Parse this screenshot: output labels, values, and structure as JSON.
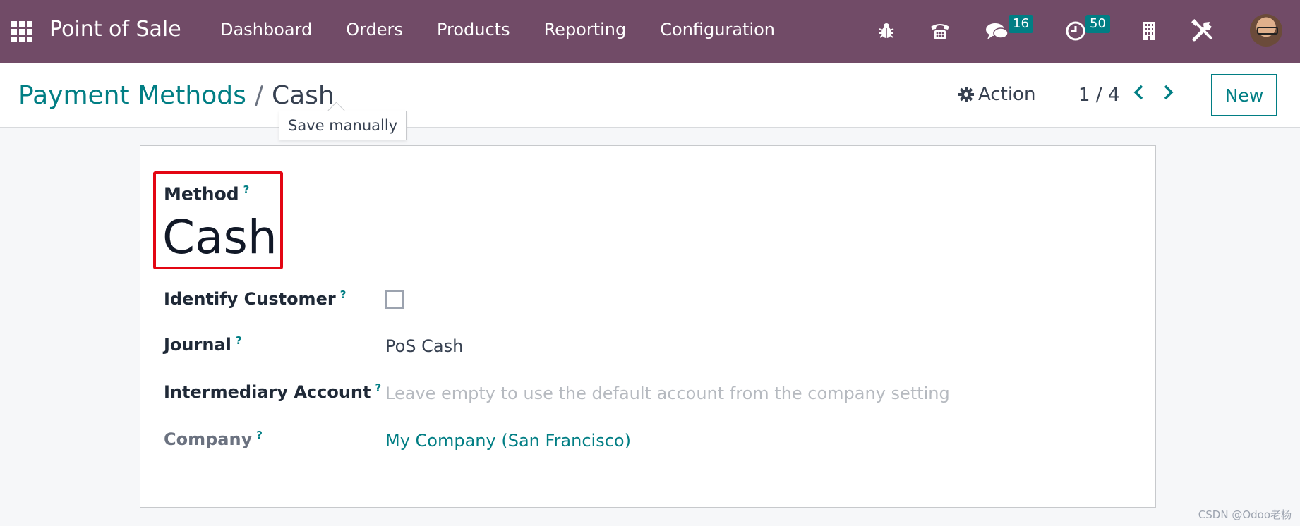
{
  "navbar": {
    "brand": "Point of Sale",
    "menu": [
      "Dashboard",
      "Orders",
      "Products",
      "Reporting",
      "Configuration"
    ],
    "icons": {
      "debug": "bug-icon",
      "phone": "phone-icon",
      "messages": "chat-icon",
      "activities": "clock-icon",
      "company": "building-icon",
      "settings": "tools-icon",
      "avatar": "user-avatar"
    },
    "messages_count": "16",
    "activities_count": "50",
    "background": "#714B67",
    "badge_color": "#017E84"
  },
  "control_panel": {
    "breadcrumb_parent": "Payment Methods",
    "breadcrumb_separator": "/",
    "breadcrumb_current": "Cash",
    "tooltip": "Save manually",
    "action_label": "Action",
    "pager": "1 / 4",
    "new_label": "New"
  },
  "form": {
    "method_label": "Method",
    "method_value": "Cash",
    "help_mark": "?",
    "fields": [
      {
        "label": "Identify Customer",
        "type": "checkbox",
        "value": false
      },
      {
        "label": "Journal",
        "value": "PoS Cash"
      },
      {
        "label": "Intermediary Account",
        "placeholder": "Leave empty to use the default account from the company setting"
      },
      {
        "label": "Company",
        "value": "My Company (San Francisco)"
      }
    ]
  },
  "watermark": "CSDN @Odoo老杨",
  "colors": {
    "accent": "#017E84",
    "highlight": "#e30613"
  }
}
